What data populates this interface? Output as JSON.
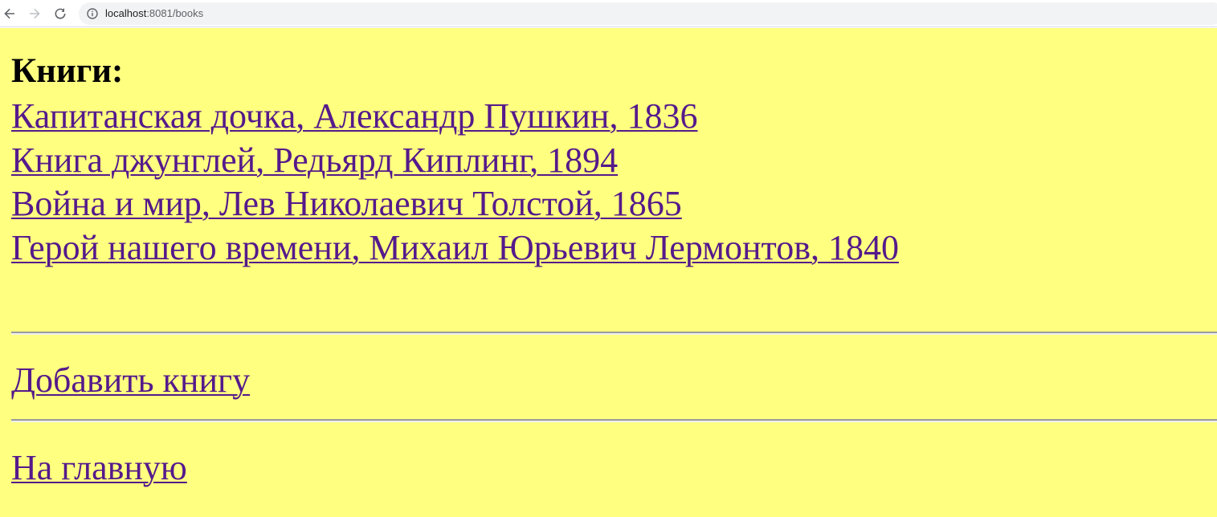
{
  "browser": {
    "url_host": "localhost",
    "url_rest": ":8081/books"
  },
  "page": {
    "title": "Книги:",
    "books": [
      {
        "label": "Капитанская дочка, Александр Пушкин, 1836"
      },
      {
        "label": "Книга джунглей, Редьярд Киплинг, 1894"
      },
      {
        "label": "Война и мир, Лев Николаевич Толстой, 1865"
      },
      {
        "label": "Герой нашего времени, Михаил Юрьевич Лермонтов, 1840"
      }
    ],
    "add_book_label": "Добавить книгу",
    "home_label": "На главную"
  },
  "colors": {
    "page_background": "#ffff80",
    "link": "#551a8b"
  },
  "icons": [
    "back-arrow-icon",
    "forward-arrow-icon",
    "reload-icon",
    "info-icon"
  ]
}
